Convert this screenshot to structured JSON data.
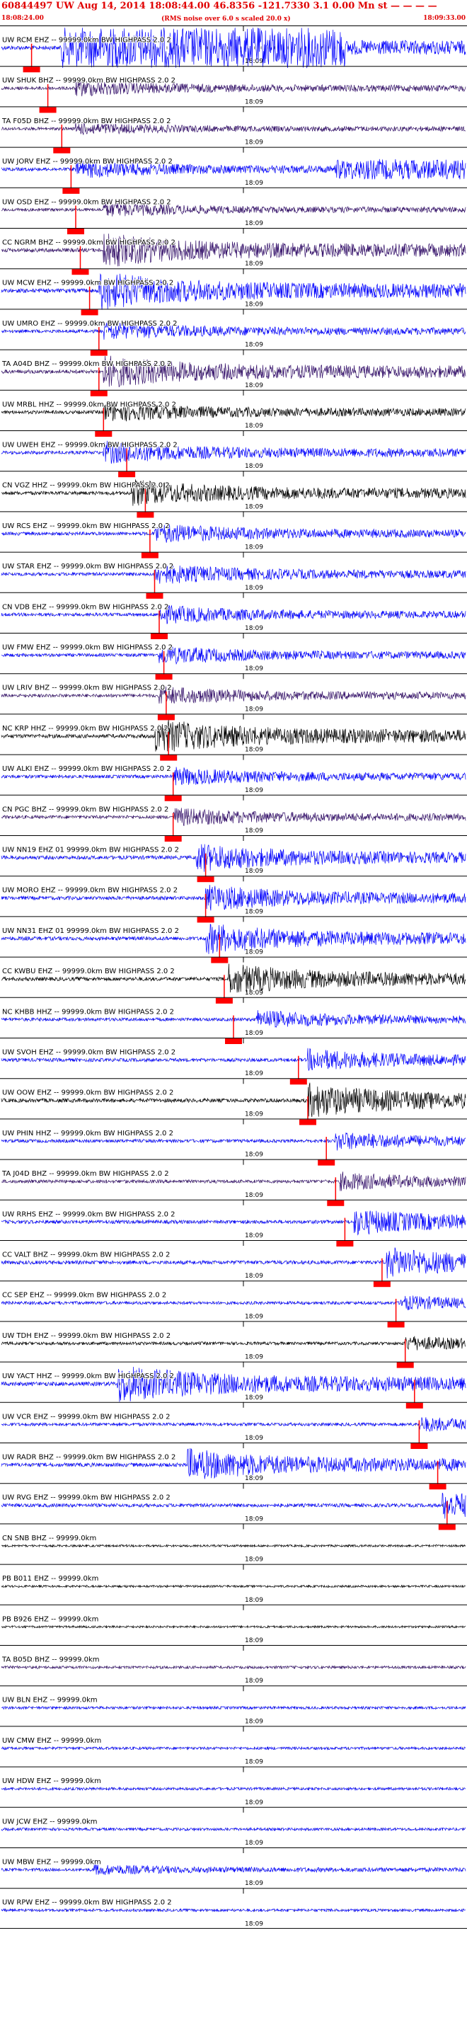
{
  "header": {
    "title": "60844497 UW Aug 14, 2014 18:08:44.00    46.8356 -121.7330  3.1 0.00 Mn st — — — —",
    "start_time": "18:08:24.00",
    "note": "(RMS noise over 6.0 s scaled 20.0 x)",
    "end_time": "18:09:33.00"
  },
  "chart_data": {
    "type": "line",
    "title": "60844497 UW Aug 14, 2014 18:08:44.00    46.8356 -121.7330  3.1 0.00 Mn st — — — —",
    "x_range": [
      "18:08:24.00",
      "18:09:33.00"
    ],
    "minute_tick_label": "18:09",
    "colors": {
      "blue": "#0000ff",
      "purple": "#34106a",
      "black": "#000000",
      "red": "#ff0000"
    },
    "traces": [
      {
        "label": "UW RCM EHZ -- 99999.0km BW  HIGHPASS  2.0  2",
        "color": "blue",
        "pick": 0.065,
        "onset": 0.14,
        "amp": 1.0,
        "band": [
          0.13,
          0.74
        ]
      },
      {
        "label": "UW SHUK BHZ -- 99999.0km BW  HIGHPASS  2.0  2",
        "color": "purple",
        "pick": 0.1,
        "onset": 0.16,
        "amp": 0.45
      },
      {
        "label": "TA F05D BHZ -- 99999.0km BW  HIGHPASS  2.0  2",
        "color": "purple",
        "pick": 0.13,
        "onset": 0.16,
        "amp": 0.35
      },
      {
        "label": "UW JORV EHZ -- 99999.0km BW  HIGHPASS  2.0  2",
        "color": "blue",
        "pick": 0.15,
        "onset": 0.16,
        "amp": 0.5,
        "band": [
          0.72,
          1.0
        ]
      },
      {
        "label": "UW OSD EHZ -- 99999.0km BW  HIGHPASS  2.0  2",
        "color": "purple",
        "pick": 0.16,
        "onset": 0.22,
        "amp": 0.4
      },
      {
        "label": "CC NGRM BHZ -- 99999.0km BW  HIGHPASS  2.0  2",
        "color": "purple",
        "pick": 0.17,
        "onset": 0.22,
        "amp": 0.9
      },
      {
        "label": "UW MCW EHZ -- 99999.0km BW  HIGHPASS  2.0  2",
        "color": "blue",
        "pick": 0.19,
        "onset": 0.21,
        "amp": 1.0
      },
      {
        "label": "UW UMRO EHZ -- 99999.0km BW  HIGHPASS  2.0  2",
        "color": "blue",
        "pick": 0.21,
        "onset": 0.22,
        "amp": 0.5
      },
      {
        "label": "TA A04D BHZ -- 99999.0km BW  HIGHPASS  2.0  2",
        "color": "purple",
        "pick": 0.21,
        "onset": 0.22,
        "amp": 0.85
      },
      {
        "label": "UW MRBL HHZ -- 99999.0km BW  HIGHPASS  2.0  2",
        "color": "black",
        "pick": 0.22,
        "onset": 0.22,
        "amp": 0.55
      },
      {
        "label": "UW UWEH EHZ -- 99999.0km BW  HIGHPASS  2.0  2",
        "color": "blue",
        "pick": 0.27,
        "onset": 0.22,
        "amp": 0.6
      },
      {
        "label": "CN VGZ HHZ -- 99999.0km BW  HIGHPASS  2.0  2",
        "color": "black",
        "pick": 0.31,
        "onset": 0.28,
        "amp": 0.7
      },
      {
        "label": "UW RCS EHZ -- 99999.0km BW  HIGHPASS  2.0  2",
        "color": "blue",
        "pick": 0.32,
        "onset": 0.33,
        "amp": 0.55
      },
      {
        "label": "UW STAR EHZ -- 99999.0km BW  HIGHPASS  2.0  2",
        "color": "blue",
        "pick": 0.33,
        "onset": 0.33,
        "amp": 0.55
      },
      {
        "label": "CN VDB EHZ -- 99999.0km BW  HIGHPASS  2.0  2",
        "color": "blue",
        "pick": 0.34,
        "onset": 0.34,
        "amp": 0.5
      },
      {
        "label": "UW FMW EHZ -- 99999.0km BW  HIGHPASS  2.0  2",
        "color": "blue",
        "pick": 0.35,
        "onset": 0.34,
        "amp": 0.5
      },
      {
        "label": "UW LRIV BHZ -- 99999.0km BW  HIGHPASS  2.0  2",
        "color": "purple",
        "pick": 0.355,
        "onset": 0.34,
        "amp": 0.5
      },
      {
        "label": "NC KRP HHZ -- 99999.0km BW  HIGHPASS  2.0  2",
        "color": "black",
        "pick": 0.36,
        "onset": 0.33,
        "amp": 0.9
      },
      {
        "label": "UW ALKI EHZ -- 99999.0km BW  HIGHPASS  2.0  2",
        "color": "blue",
        "pick": 0.37,
        "onset": 0.37,
        "amp": 0.5
      },
      {
        "label": "CN PGC BHZ -- 99999.0km BW  HIGHPASS  2.0  2",
        "color": "purple",
        "pick": 0.37,
        "onset": 0.37,
        "amp": 0.5
      },
      {
        "label": "UW NN19 EHZ 01 99999.0km BW  HIGHPASS  2.0  2",
        "color": "blue",
        "pick": 0.44,
        "onset": 0.42,
        "amp": 0.75
      },
      {
        "label": "UW MORO EHZ -- 99999.0km BW  HIGHPASS  2.0  2",
        "color": "blue",
        "pick": 0.44,
        "onset": 0.44,
        "amp": 0.7
      },
      {
        "label": "UW NN31 EHZ 01 99999.0km BW  HIGHPASS  2.0  2",
        "color": "blue",
        "pick": 0.47,
        "onset": 0.44,
        "amp": 0.8
      },
      {
        "label": "CC KWBU EHZ -- 99999.0km BW  HIGHPASS  2.0  2",
        "color": "black",
        "pick": 0.48,
        "onset": 0.49,
        "amp": 0.8
      },
      {
        "label": "NC KHBB HHZ -- 99999.0km BW  HIGHPASS  2.0  2",
        "color": "blue",
        "pick": 0.5,
        "onset": 0.55,
        "amp": 0.5
      },
      {
        "label": "UW SVOH EHZ -- 99999.0km BW  HIGHPASS  2.0  2",
        "color": "blue",
        "pick": 0.64,
        "onset": 0.66,
        "amp": 0.6
      },
      {
        "label": "UW OOW EHZ -- 99999.0km BW  HIGHPASS  2.0  2",
        "color": "black",
        "pick": 0.66,
        "onset": 0.66,
        "amp": 0.9
      },
      {
        "label": "UW PHIN HHZ -- 99999.0km BW  HIGHPASS  2.0  2",
        "color": "blue",
        "pick": 0.7,
        "onset": 0.72,
        "amp": 0.5
      },
      {
        "label": "TA J04D BHZ -- 99999.0km BW  HIGHPASS  2.0  2",
        "color": "purple",
        "pick": 0.72,
        "onset": 0.73,
        "amp": 0.5
      },
      {
        "label": "UW RRHS EHZ -- 99999.0km BW  HIGHPASS  2.0  2",
        "color": "blue",
        "pick": 0.74,
        "onset": 0.76,
        "amp": 0.7
      },
      {
        "label": "CC VALT BHZ -- 99999.0km BW  HIGHPASS  2.0  2",
        "color": "blue",
        "pick": 0.82,
        "onset": 0.83,
        "amp": 0.8
      },
      {
        "label": "CC SEP EHZ -- 99999.0km BW  HIGHPASS  2.0  2",
        "color": "blue",
        "pick": 0.85,
        "onset": 0.86,
        "amp": 0.4
      },
      {
        "label": "UW TDH EHZ -- 99999.0km BW  HIGHPASS  2.0  2",
        "color": "black",
        "pick": 0.87,
        "onset": 0.87,
        "amp": 0.4
      },
      {
        "label": "UW YACT HHZ -- 99999.0km BW  HIGHPASS  2.0  2",
        "color": "blue",
        "pick": 0.89,
        "onset": 0.25,
        "amp": 1.0
      },
      {
        "label": "UW VCR EHZ -- 99999.0km BW  HIGHPASS  2.0  2",
        "color": "blue",
        "pick": 0.9,
        "onset": 0.9,
        "amp": 0.4
      },
      {
        "label": "UW RADR BHZ -- 99999.0km BW  HIGHPASS  2.0  2",
        "color": "blue",
        "pick": 0.94,
        "onset": 0.4,
        "amp": 0.85
      },
      {
        "label": "UW RVG EHZ -- 99999.0km BW  HIGHPASS  2.0  2",
        "color": "blue",
        "pick": 0.96,
        "onset": 0.95,
        "amp": 0.7
      },
      {
        "label": "CN SNB BHZ -- 99999.0km",
        "color": "black",
        "pick": null,
        "onset": 1.1,
        "amp": 0
      },
      {
        "label": "PB B011 EHZ -- 99999.0km",
        "color": "black",
        "pick": null,
        "onset": 1.1,
        "amp": 0
      },
      {
        "label": "PB B926 EHZ -- 99999.0km",
        "color": "black",
        "pick": null,
        "onset": 1.1,
        "amp": 0
      },
      {
        "label": "TA B05D BHZ -- 99999.0km",
        "color": "purple",
        "pick": null,
        "onset": 1.1,
        "amp": 0.15
      },
      {
        "label": "UW BLN EHZ -- 99999.0km",
        "color": "blue",
        "pick": null,
        "onset": 1.1,
        "amp": 0.15
      },
      {
        "label": "UW CMW EHZ -- 99999.0km",
        "color": "blue",
        "pick": null,
        "onset": 1.1,
        "amp": 0.12
      },
      {
        "label": "UW HDW EHZ -- 99999.0km",
        "color": "blue",
        "pick": null,
        "onset": 1.1,
        "amp": 0.15
      },
      {
        "label": "UW JCW EHZ -- 99999.0km",
        "color": "blue",
        "pick": null,
        "onset": 1.1,
        "amp": 0.15
      },
      {
        "label": "UW MBW EHZ -- 99999.0km",
        "color": "blue",
        "pick": null,
        "onset": 0.2,
        "amp": 0.3
      },
      {
        "label": "UW RPW EHZ -- 99999.0km BW  HIGHPASS  2.0  2",
        "color": "blue",
        "pick": null,
        "onset": 1.1,
        "amp": 0.15
      }
    ]
  }
}
